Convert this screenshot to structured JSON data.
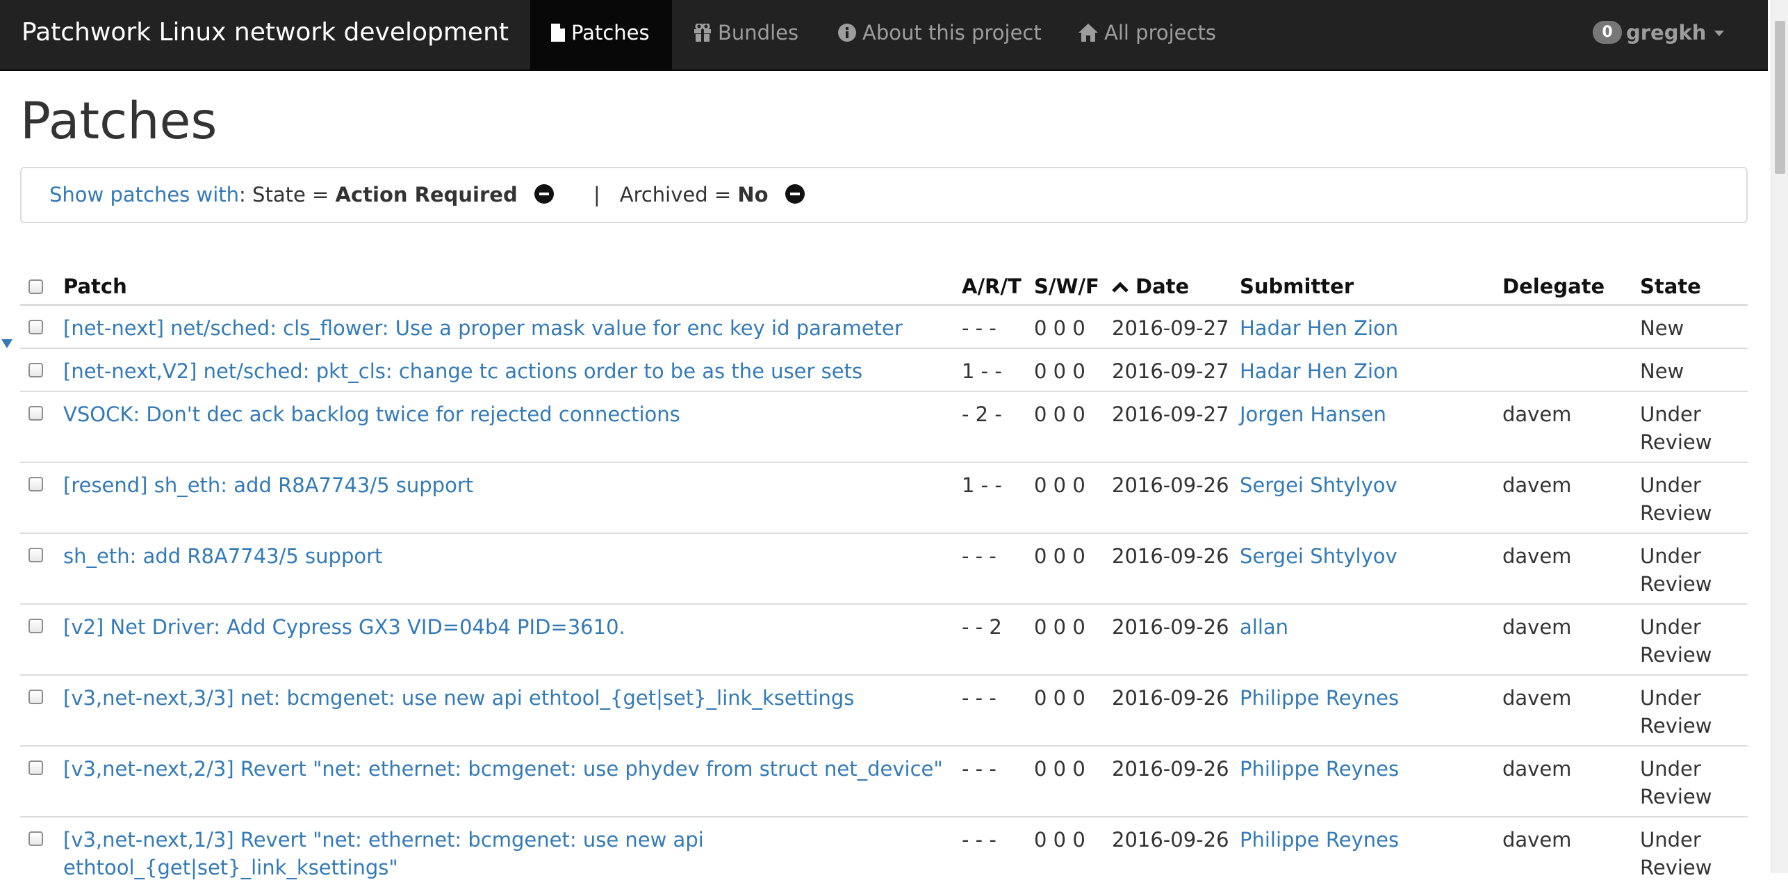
{
  "navbar": {
    "brand": "Patchwork Linux network development",
    "items": [
      {
        "label": "Patches",
        "icon": "file-icon"
      },
      {
        "label": "Bundles",
        "icon": "gift-icon"
      },
      {
        "label": "About this project",
        "icon": "info-sign-icon"
      },
      {
        "label": "All projects",
        "icon": "home-icon"
      }
    ],
    "user": {
      "count": "0",
      "name": "gregkh"
    }
  },
  "page": {
    "title": "Patches"
  },
  "filter": {
    "prefix": "Show patches with",
    "colon": ":",
    "state_label": "State =",
    "state_value": "Action Required",
    "separator": "|",
    "archived_label": "Archived =",
    "archived_value": "No"
  },
  "table": {
    "headers": {
      "patch": "Patch",
      "art": "A/R/T",
      "swf": "S/W/F",
      "date": "Date",
      "submitter": "Submitter",
      "delegate": "Delegate",
      "state": "State"
    },
    "rows": [
      {
        "patch": "[net-next] net/sched: cls_flower: Use a proper mask value for enc key id parameter",
        "art": "- - -",
        "swf": "0 0 0",
        "date": "2016-09-27",
        "submitter": "Hadar Hen Zion",
        "delegate": "",
        "state": "New"
      },
      {
        "patch": "[net-next,V2] net/sched: pkt_cls: change tc actions order to be as the user sets",
        "art": "1 - -",
        "swf": "0 0 0",
        "date": "2016-09-27",
        "submitter": "Hadar Hen Zion",
        "delegate": "",
        "state": "New"
      },
      {
        "patch": "VSOCK: Don't dec ack backlog twice for rejected connections",
        "art": "- 2 -",
        "swf": "0 0 0",
        "date": "2016-09-27",
        "submitter": "Jorgen Hansen",
        "delegate": "davem",
        "state": "Under Review"
      },
      {
        "patch": "[resend] sh_eth: add R8A7743/5 support",
        "art": "1 - -",
        "swf": "0 0 0",
        "date": "2016-09-26",
        "submitter": "Sergei Shtylyov",
        "delegate": "davem",
        "state": "Under Review"
      },
      {
        "patch": "sh_eth: add R8A7743/5 support",
        "art": "- - -",
        "swf": "0 0 0",
        "date": "2016-09-26",
        "submitter": "Sergei Shtylyov",
        "delegate": "davem",
        "state": "Under Review"
      },
      {
        "patch": "[v2] Net Driver: Add Cypress GX3 VID=04b4 PID=3610.",
        "art": "- - 2",
        "swf": "0 0 0",
        "date": "2016-09-26",
        "submitter": "allan",
        "delegate": "davem",
        "state": "Under Review"
      },
      {
        "patch": "[v3,net-next,3/3] net: bcmgenet: use new api ethtool_{get|set}_link_ksettings",
        "art": "- - -",
        "swf": "0 0 0",
        "date": "2016-09-26",
        "submitter": "Philippe Reynes",
        "delegate": "davem",
        "state": "Under Review"
      },
      {
        "patch": "[v3,net-next,2/3] Revert \"net: ethernet: bcmgenet: use phydev from struct net_device\"",
        "art": "- - -",
        "swf": "0 0 0",
        "date": "2016-09-26",
        "submitter": "Philippe Reynes",
        "delegate": "davem",
        "state": "Under Review"
      },
      {
        "patch": "[v3,net-next,1/3] Revert \"net: ethernet: bcmgenet: use new api ethtool_{get|set}_link_ksettings\"",
        "art": "- - -",
        "swf": "0 0 0",
        "date": "2016-09-26",
        "submitter": "Philippe Reynes",
        "delegate": "davem",
        "state": "Under Review"
      }
    ]
  },
  "colors": {
    "navbar_bg": "#222222",
    "navbar_active_bg": "#080808",
    "link": "#337ab7",
    "text": "#333333",
    "border": "#dddddd"
  }
}
